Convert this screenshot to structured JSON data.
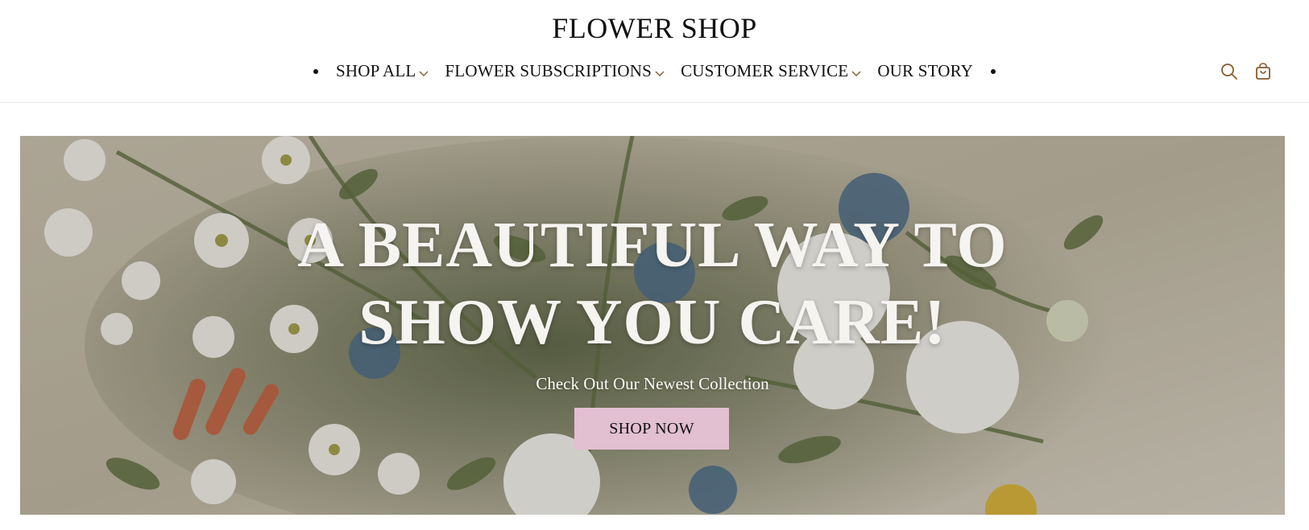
{
  "header": {
    "logo": "FLOWER SHOP",
    "nav": [
      {
        "label": "SHOP ALL",
        "has_dropdown": true
      },
      {
        "label": "FLOWER SUBSCRIPTIONS",
        "has_dropdown": true
      },
      {
        "label": "CUSTOMER SERVICE",
        "has_dropdown": true
      },
      {
        "label": "OUR STORY",
        "has_dropdown": false
      }
    ],
    "icons": [
      "search-icon",
      "shopping-bag-icon"
    ],
    "icon_color": "#8a5a2b"
  },
  "hero": {
    "title_line1": "A BEAUTIFUL WAY TO",
    "title_line2": "SHOW YOU CARE!",
    "subtitle": "Check Out Our Newest Collection",
    "cta_label": "SHOP NOW",
    "cta_color": "#e2bfd1"
  }
}
